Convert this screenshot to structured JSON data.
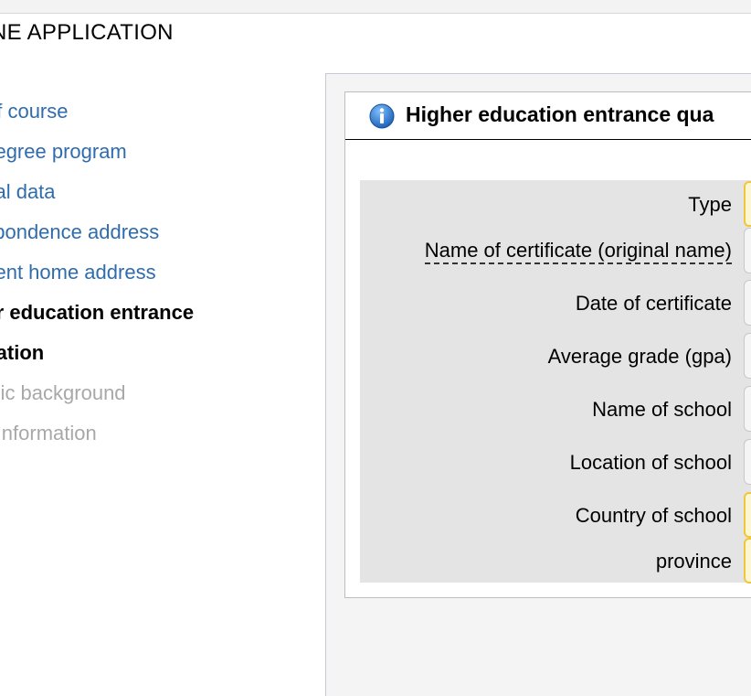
{
  "app": {
    "title": "NE APPLICATION"
  },
  "sidebar": {
    "items": [
      {
        "label": "of course",
        "state": "link"
      },
      {
        "label": "t degree program",
        "state": "link"
      },
      {
        "label": "onal data",
        "state": "link"
      },
      {
        "label": "espondence address",
        "state": "link"
      },
      {
        "label": "anent home address",
        "state": "link"
      },
      {
        "label": "her education entrance",
        "state": "active"
      },
      {
        "label": "fication",
        "state": "active"
      },
      {
        "label": "emic background",
        "state": "disabled"
      },
      {
        "label": "er Information",
        "state": "disabled"
      }
    ]
  },
  "panel": {
    "icon": "info-icon",
    "title": "Higher education entrance qua"
  },
  "form": {
    "fields": [
      {
        "label": "Type",
        "control": "select"
      },
      {
        "label": "Name of certificate (original name)",
        "control": "text"
      },
      {
        "label": "Date of certificate",
        "control": "text"
      },
      {
        "label": "Average grade (gpa)",
        "control": "text"
      },
      {
        "label": "Name of school",
        "control": "text"
      },
      {
        "label": "Location of school",
        "control": "text"
      },
      {
        "label": "Country of school",
        "control": "select"
      },
      {
        "label": "province",
        "control": "select"
      }
    ]
  },
  "colors": {
    "link": "#2f6cae",
    "disabled": "#a8a8a8",
    "select_border": "#f0c63c",
    "info_icon": "#2a7fd4"
  }
}
